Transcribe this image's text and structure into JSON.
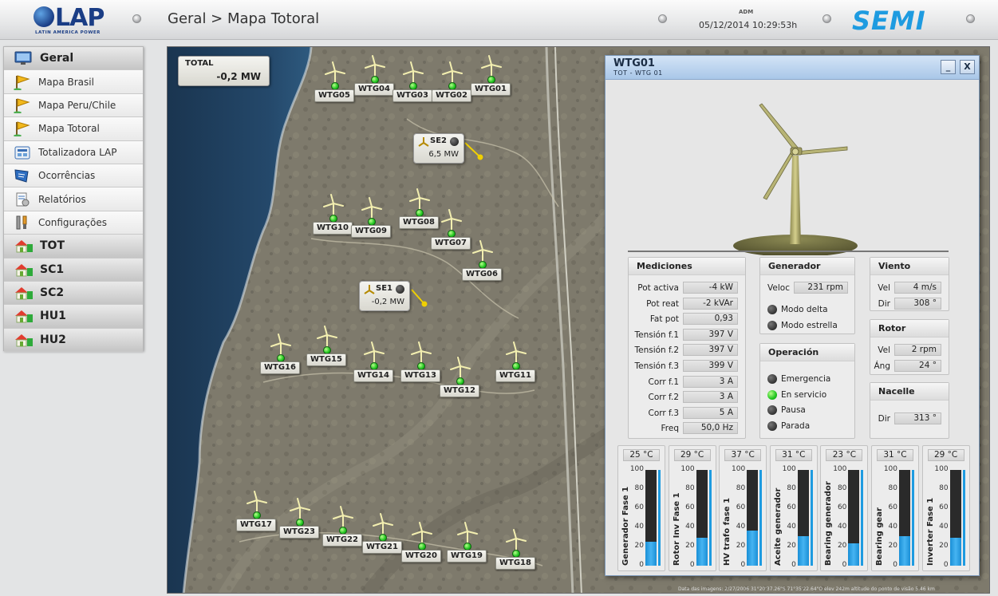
{
  "header": {
    "logo_text": "LAP",
    "logo_subtitle": "LATIN AMERICA POWER",
    "breadcrumb": "Geral > Mapa Totoral",
    "user": "ADM",
    "datetime": "05/12/2014 10:29:53h",
    "brand_logo": "SEMI"
  },
  "sidebar": {
    "items": [
      {
        "label": "Geral",
        "type": "major",
        "icon": "monitor-icon"
      },
      {
        "label": "Mapa Brasil",
        "type": "minor",
        "icon": "flag-icon"
      },
      {
        "label": "Mapa Peru/Chile",
        "type": "minor",
        "icon": "flag-icon"
      },
      {
        "label": "Mapa Totoral",
        "type": "minor",
        "icon": "flag-icon"
      },
      {
        "label": "Totalizadora LAP",
        "type": "minor",
        "icon": "gauge-icon"
      },
      {
        "label": "Ocorrências",
        "type": "minor",
        "icon": "list-icon"
      },
      {
        "label": "Relatórios",
        "type": "minor",
        "icon": "report-icon"
      },
      {
        "label": "Configurações",
        "type": "minor",
        "icon": "tools-icon"
      },
      {
        "label": "TOT",
        "type": "major",
        "icon": "home-icon"
      },
      {
        "label": "SC1",
        "type": "major",
        "icon": "home-icon"
      },
      {
        "label": "SC2",
        "type": "major",
        "icon": "home-icon"
      },
      {
        "label": "HU1",
        "type": "major",
        "icon": "home-icon"
      },
      {
        "label": "HU2",
        "type": "major",
        "icon": "home-icon"
      }
    ]
  },
  "map": {
    "total": {
      "label": "TOTAL",
      "value": "-0,2 MW"
    },
    "substations": [
      {
        "name": "SE2",
        "value": "6,5 MW"
      },
      {
        "name": "SE1",
        "value": "-0,2 MW"
      }
    ],
    "turbines": [
      "WTG05",
      "WTG04",
      "WTG03",
      "WTG02",
      "WTG01",
      "WTG10",
      "WTG09",
      "WTG08",
      "WTG07",
      "WTG06",
      "WTG16",
      "WTG15",
      "WTG14",
      "WTG13",
      "WTG12",
      "WTG11",
      "WTG17",
      "WTG23",
      "WTG22",
      "WTG21",
      "WTG20",
      "WTG19",
      "WTG18"
    ],
    "footer": "Data das imagens: 2/27/2006    31°20'37.26\"S  71°35'22.64\"O   elev  242m     altitude do ponto de visão  5.46 km",
    "colors": {
      "turbine_status": "#1fc41f",
      "link_line": "#f0d000"
    }
  },
  "panel": {
    "title": "WTG01",
    "subtitle": "TOT - WTG 01",
    "minimize": "_",
    "close": "X",
    "mediciones": {
      "title": "Mediciones",
      "rows": [
        {
          "label": "Pot activa",
          "value": "-4 kW"
        },
        {
          "label": "Pot reat",
          "value": "-2 kVAr"
        },
        {
          "label": "Fat pot",
          "value": "0,93"
        },
        {
          "label": "Tensión f.1",
          "value": "397 V"
        },
        {
          "label": "Tensión f.2",
          "value": "397 V"
        },
        {
          "label": "Tensión f.3",
          "value": "399 V"
        },
        {
          "label": "Corr f.1",
          "value": "3 A"
        },
        {
          "label": "Corr f.2",
          "value": "3 A"
        },
        {
          "label": "Corr f.3",
          "value": "5 A"
        },
        {
          "label": "Freq",
          "value": "50,0 Hz"
        }
      ]
    },
    "generador": {
      "title": "Generador",
      "veloc_label": "Veloc",
      "veloc_value": "231 rpm",
      "modes": [
        {
          "label": "Modo delta",
          "on": false
        },
        {
          "label": "Modo estrella",
          "on": false
        }
      ]
    },
    "operacion": {
      "title": "Operación",
      "states": [
        {
          "label": "Emergencia",
          "on": false
        },
        {
          "label": "En servicio",
          "on": true
        },
        {
          "label": "Pausa",
          "on": false
        },
        {
          "label": "Parada",
          "on": false
        }
      ]
    },
    "viento": {
      "title": "Viento",
      "rows": [
        {
          "label": "Vel",
          "value": "4 m/s"
        },
        {
          "label": "Dir",
          "value": "308 °"
        }
      ]
    },
    "rotor": {
      "title": "Rotor",
      "rows": [
        {
          "label": "Vel",
          "value": "2 rpm"
        },
        {
          "label": "Áng",
          "value": "24 °"
        }
      ]
    },
    "nacelle": {
      "title": "Nacelle",
      "rows": [
        {
          "label": "Dir",
          "value": "313 °"
        }
      ]
    },
    "gauges": {
      "ticks": [
        "100",
        "80",
        "60",
        "40",
        "20",
        "0"
      ],
      "items": [
        {
          "name": "Generador Fase 1",
          "temp": "25 °C",
          "level": 25
        },
        {
          "name": "Rotor Inv Fase 1",
          "temp": "29 °C",
          "level": 29
        },
        {
          "name": "HV trafo fase 1",
          "temp": "37 °C",
          "level": 37
        },
        {
          "name": "Aceite generador",
          "temp": "31 °C",
          "level": 31
        },
        {
          "name": "Bearing generador",
          "temp": "23 °C",
          "level": 23
        },
        {
          "name": "Bearing gear",
          "temp": "31 °C",
          "level": 31
        },
        {
          "name": "Inverter Fase 1",
          "temp": "29 °C",
          "level": 29
        }
      ]
    }
  }
}
